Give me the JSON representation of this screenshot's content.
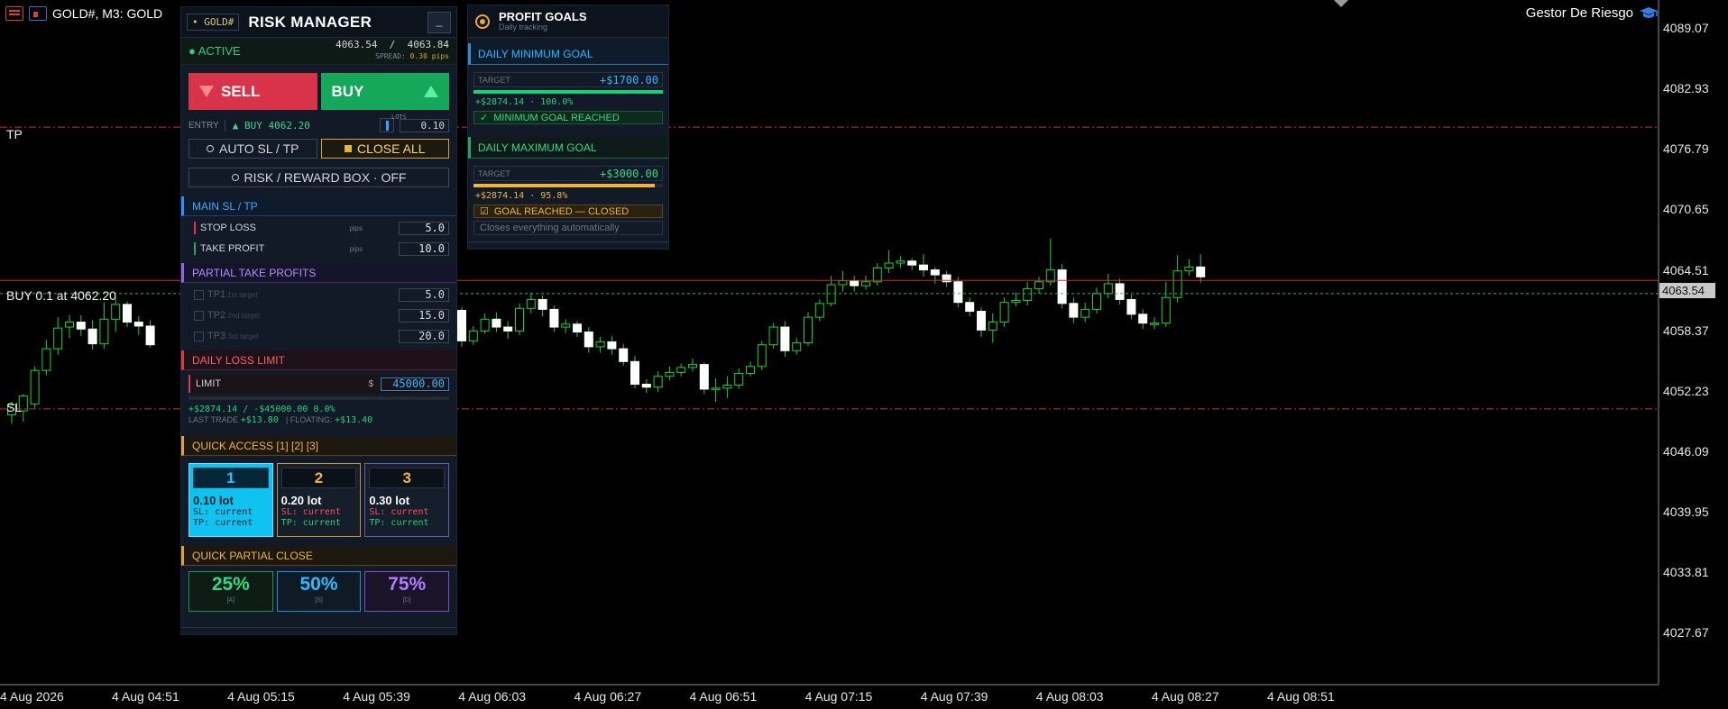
{
  "window": {
    "symbol_label": "GOLD#, M3:  GOLD",
    "brand_label": "Gestor De Riesgo"
  },
  "chart": {
    "current_price": "4063.54",
    "line_tags": {
      "tp": "TP",
      "buy": "BUY 0.1 at 4062.20",
      "sl": "SL"
    },
    "colors": {
      "tp_sl_line": "#d42a2a",
      "bid_line": "#d42a2a",
      "ask_line": "#1fc04a",
      "candle_up": "#ffffff",
      "wick": "#19d433"
    }
  },
  "chart_data": {
    "type": "candlestick",
    "y_ticks": [
      "4089.07",
      "4082.93",
      "4076.79",
      "4070.65",
      "4064.51",
      "4058.37",
      "4052.23",
      "4046.09",
      "4039.95",
      "4033.81",
      "4027.67"
    ],
    "x_ticks": [
      "4 Aug 2026",
      "4 Aug 04:51",
      "4 Aug 05:15",
      "4 Aug 05:39",
      "4 Aug 06:03",
      "4 Aug 06:27",
      "4 Aug 06:51",
      "4 Aug 07:15",
      "4 Aug 07:39",
      "4 Aug 08:03",
      "4 Aug 08:27",
      "4 Aug 08:51"
    ],
    "ylim": [
      4022.5,
      4092.0
    ],
    "levels": {
      "tp": 4079.1,
      "entry": 4062.2,
      "sl": 4050.5,
      "bid": 4063.54,
      "ask": 4063.84
    },
    "candles_visible_left": [
      [
        4049.9,
        4050.9,
        4049.0,
        4051.2
      ],
      [
        4050.3,
        4051.8,
        4049.2,
        4052.0
      ],
      [
        4051.0,
        4054.4,
        4050.6,
        4054.8
      ],
      [
        4054.4,
        4056.6,
        4053.9,
        4057.5
      ],
      [
        4056.6,
        4058.7,
        4056.0,
        4059.8
      ],
      [
        4058.8,
        4059.3,
        4057.7,
        4060.0
      ],
      [
        4059.3,
        4058.6,
        4057.9,
        4060.0
      ],
      [
        4058.6,
        4057.1,
        4056.5,
        4059.5
      ],
      [
        4057.1,
        4059.6,
        4056.6,
        4061.3
      ],
      [
        4059.6,
        4061.1,
        4058.3,
        4061.8
      ],
      [
        4061.1,
        4059.3,
        4058.8,
        4061.4
      ],
      [
        4059.3,
        4058.9,
        4058.0,
        4059.9
      ],
      [
        4058.9,
        4057.0,
        4056.7,
        4059.5
      ]
    ],
    "candles_visible_right": [
      [
        4060.5,
        4057.4,
        4056.8,
        4060.8
      ],
      [
        4057.4,
        4058.4,
        4057.0,
        4058.9
      ],
      [
        4058.4,
        4059.6,
        4058.1,
        4060.2
      ],
      [
        4059.6,
        4058.8,
        4058.3,
        4060.3
      ],
      [
        4058.8,
        4058.4,
        4057.6,
        4059.4
      ],
      [
        4058.4,
        4060.7,
        4058.0,
        4061.2
      ],
      [
        4060.7,
        4061.6,
        4060.2,
        4062.3
      ],
      [
        4061.6,
        4060.6,
        4059.9,
        4062.0
      ],
      [
        4060.6,
        4058.8,
        4058.3,
        4061.0
      ],
      [
        4058.8,
        4059.1,
        4058.2,
        4059.6
      ],
      [
        4059.1,
        4058.3,
        4057.8,
        4059.4
      ],
      [
        4058.3,
        4056.8,
        4056.2,
        4058.8
      ],
      [
        4056.8,
        4057.3,
        4056.2,
        4057.8
      ],
      [
        4057.3,
        4056.6,
        4056.0,
        4057.9
      ],
      [
        4056.6,
        4055.3,
        4054.9,
        4057.1
      ],
      [
        4055.3,
        4053.0,
        4052.6,
        4055.9
      ],
      [
        4053.0,
        4052.7,
        4052.1,
        4053.5
      ],
      [
        4052.7,
        4053.8,
        4052.2,
        4054.3
      ],
      [
        4053.8,
        4054.2,
        4053.4,
        4054.8
      ],
      [
        4054.2,
        4054.7,
        4053.8,
        4055.1
      ],
      [
        4054.7,
        4055.0,
        4054.3,
        4055.6
      ],
      [
        4055.0,
        4052.5,
        4052.0,
        4055.2
      ],
      [
        4052.5,
        4052.6,
        4051.2,
        4053.6
      ],
      [
        4052.6,
        4052.9,
        4051.6,
        4053.8
      ],
      [
        4052.9,
        4054.1,
        4052.5,
        4054.6
      ],
      [
        4054.1,
        4054.8,
        4053.8,
        4055.3
      ],
      [
        4054.8,
        4057.0,
        4054.4,
        4057.4
      ],
      [
        4057.0,
        4058.8,
        4056.6,
        4059.2
      ],
      [
        4058.8,
        4056.4,
        4055.8,
        4059.4
      ],
      [
        4056.4,
        4057.2,
        4056.0,
        4057.7
      ],
      [
        4057.2,
        4059.8,
        4056.9,
        4060.3
      ],
      [
        4059.8,
        4061.2,
        4059.4,
        4061.6
      ],
      [
        4061.2,
        4063.1,
        4060.9,
        4064.0
      ],
      [
        4063.1,
        4063.5,
        4062.4,
        4064.5
      ],
      [
        4063.5,
        4063.0,
        4062.4,
        4064.0
      ],
      [
        4063.0,
        4063.4,
        4062.6,
        4064.0
      ],
      [
        4063.4,
        4064.8,
        4063.0,
        4065.3
      ],
      [
        4064.8,
        4065.3,
        4064.3,
        4066.6
      ],
      [
        4065.3,
        4065.5,
        4064.8,
        4066.0
      ],
      [
        4065.5,
        4065.1,
        4064.6,
        4065.8
      ],
      [
        4065.1,
        4064.6,
        4063.9,
        4066.2
      ],
      [
        4064.6,
        4064.1,
        4063.2,
        4064.9
      ],
      [
        4064.1,
        4063.4,
        4062.9,
        4064.5
      ],
      [
        4063.4,
        4061.3,
        4060.8,
        4063.9
      ],
      [
        4061.3,
        4060.4,
        4059.9,
        4061.8
      ],
      [
        4060.4,
        4058.5,
        4057.8,
        4060.8
      ],
      [
        4058.5,
        4059.3,
        4057.2,
        4060.2
      ],
      [
        4059.3,
        4061.3,
        4058.8,
        4061.8
      ],
      [
        4061.3,
        4061.5,
        4060.9,
        4062.3
      ],
      [
        4061.5,
        4062.7,
        4061.0,
        4063.4
      ],
      [
        4062.7,
        4063.4,
        4062.2,
        4063.9
      ],
      [
        4063.4,
        4064.6,
        4063.0,
        4067.8
      ],
      [
        4064.6,
        4061.2,
        4060.7,
        4065.2
      ],
      [
        4061.2,
        4059.8,
        4059.2,
        4061.8
      ],
      [
        4059.8,
        4060.6,
        4059.3,
        4061.3
      ],
      [
        4060.6,
        4062.2,
        4060.2,
        4062.8
      ],
      [
        4062.2,
        4063.2,
        4061.7,
        4064.2
      ],
      [
        4063.2,
        4061.6,
        4061.1,
        4063.7
      ],
      [
        4061.6,
        4060.1,
        4059.6,
        4062.1
      ],
      [
        4060.1,
        4059.2,
        4058.6,
        4060.6
      ],
      [
        4059.2,
        4059.2,
        4058.6,
        4059.8
      ],
      [
        4059.2,
        4061.8,
        4058.8,
        4063.4
      ],
      [
        4061.8,
        4064.5,
        4061.3,
        4066.1
      ],
      [
        4064.5,
        4064.9,
        4064.0,
        4065.7
      ],
      [
        4064.9,
        4063.9,
        4063.3,
        4066.2
      ]
    ]
  },
  "risk_manager": {
    "symbol_tag": "GOLD#",
    "title": "RISK MANAGER",
    "minimize": "_",
    "status": "ACTIVE",
    "bid": "4063.54",
    "price_sep": "/",
    "ask": "4063.84",
    "spread_label": "SPREAD:",
    "spread_value": "0.30 pips",
    "sell_label": "SELL",
    "buy_label": "BUY",
    "entry_label": "ENTRY",
    "entry_value": "BUY  4062.20",
    "lots_label": "LOTS",
    "lots_value": "0.10",
    "auto_sltp": "AUTO  SL / TP",
    "close_all": "CLOSE ALL",
    "rr_box": "RISK / REWARD BOX  ·  OFF",
    "main_sltp": {
      "header": "MAIN SL / TP",
      "rows": [
        {
          "label": "STOP LOSS",
          "unit": "pips",
          "value": "5.0",
          "color": "#e03848"
        },
        {
          "label": "TAKE PROFIT",
          "unit": "pips",
          "value": "10.0",
          "color": "#1fa866"
        }
      ]
    },
    "partial_tp": {
      "header": "PARTIAL TAKE PROFITS",
      "rows": [
        {
          "label": "TP1",
          "sub": "1st target",
          "value": "5.0"
        },
        {
          "label": "TP2",
          "sub": "2nd target",
          "value": "15.0"
        },
        {
          "label": "TP3",
          "sub": "3rd target",
          "value": "20.0"
        }
      ]
    },
    "daily_loss": {
      "header": "DAILY LOSS LIMIT",
      "limit_label": "LIMIT",
      "currency": "$",
      "limit_value": "45000.00",
      "pnl_line": "+$2874.14   /   -$45000.00   0.0%",
      "last_trade_label": "LAST TRADE",
      "last_trade_value": "+$13.80",
      "floating_label": "FLOATING:",
      "floating_value": "+$13.40"
    },
    "quick_access": {
      "header": "QUICK ACCESS   [1] [2] [3]",
      "cards": [
        {
          "num": "1",
          "lot": "0.10 lot",
          "sl": "SL: current",
          "tp": "TP: current"
        },
        {
          "num": "2",
          "lot": "0.20 lot",
          "sl": "SL: current",
          "tp": "TP: current"
        },
        {
          "num": "3",
          "lot": "0.30 lot",
          "sl": "SL: current",
          "tp": "TP: current"
        }
      ]
    },
    "partial_close": {
      "header": "QUICK PARTIAL CLOSE",
      "buttons": [
        {
          "pct": "25%",
          "key": "[A]"
        },
        {
          "pct": "50%",
          "key": "[S]"
        },
        {
          "pct": "75%",
          "key": "[D]"
        }
      ]
    }
  },
  "profit_goals": {
    "title": "PROFIT GOALS",
    "subtitle": "Daily tracking",
    "min_goal": {
      "header": "DAILY MINIMUM GOAL",
      "target_label": "TARGET",
      "target_value": "+$1700.00",
      "progress": 1.0,
      "stat": "+$2874.14   ·   100.0%",
      "badge": "MINIMUM GOAL REACHED"
    },
    "max_goal": {
      "header": "DAILY MAXIMUM GOAL",
      "target_label": "TARGET",
      "target_value": "+$3000.00",
      "progress": 0.958,
      "stat": "+$2874.14   ·   95.8%",
      "badge": "GOAL REACHED — CLOSED",
      "note": "Closes everything automatically"
    }
  }
}
